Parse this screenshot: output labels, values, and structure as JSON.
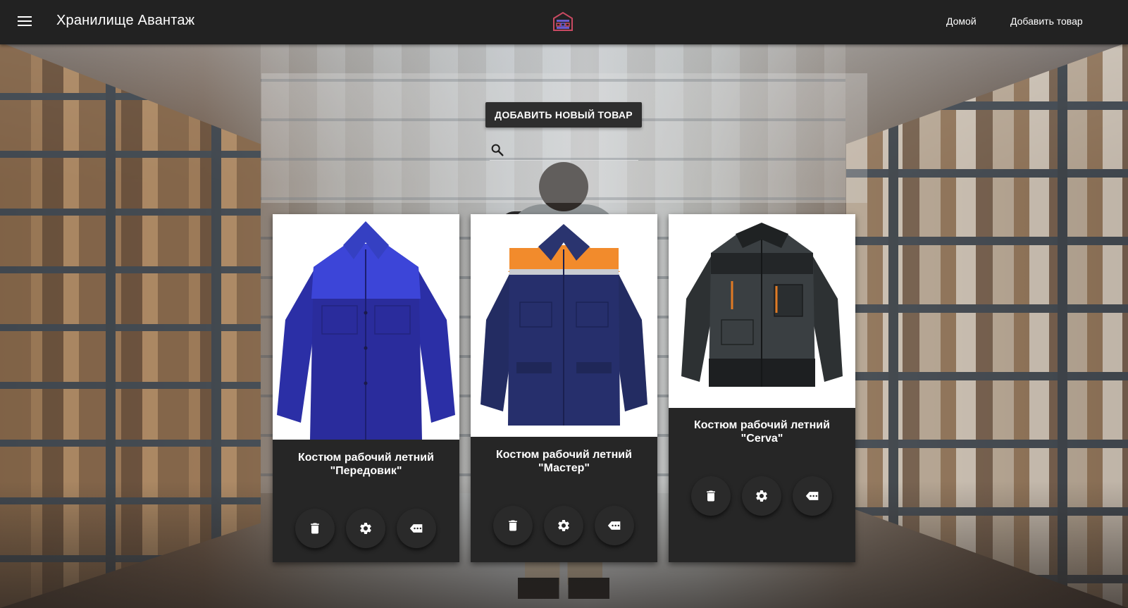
{
  "app": {
    "title": "Хранилище Авантаж",
    "logo_icon": "warehouse-logo-icon"
  },
  "nav": {
    "home_label": "Домой",
    "add_product_label": "Добавить товар"
  },
  "search_panel": {
    "add_button_label": "ДОБАВИТЬ НОВЫЙ ТОВАР",
    "search_value": "",
    "search_placeholder": ""
  },
  "products": [
    {
      "title": "Костюм рабочий летний \"Передовик\"",
      "image": "jacket-blue-royal",
      "actions": [
        "delete-icon",
        "settings-icon",
        "tag-icon"
      ]
    },
    {
      "title": "Костюм рабочий летний \"Мастер\"",
      "image": "jacket-navy-orange",
      "actions": [
        "delete-icon",
        "settings-icon",
        "tag-icon"
      ]
    },
    {
      "title": "Костюм рабочий летний \"Cerva\"",
      "image": "jacket-black-grey",
      "actions": [
        "delete-icon",
        "settings-icon",
        "tag-icon"
      ]
    }
  ],
  "colors": {
    "appbar": "#222222",
    "card": "#262626",
    "button": "#2e2e2e",
    "logo_accent": "#d04a5a"
  }
}
